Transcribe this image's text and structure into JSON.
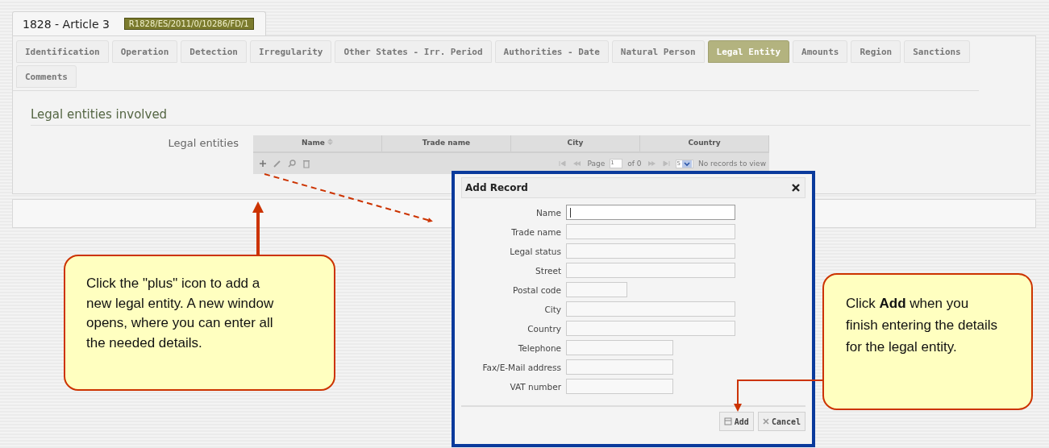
{
  "record": {
    "title": "1828 - Article 3",
    "reference": "R1828/ES/2011/0/10286/FD/1"
  },
  "tabs": [
    {
      "label": "Identification",
      "selected": false
    },
    {
      "label": "Operation",
      "selected": false
    },
    {
      "label": "Detection",
      "selected": false
    },
    {
      "label": "Irregularity",
      "selected": false
    },
    {
      "label": "Other States - Irr. Period",
      "selected": false
    },
    {
      "label": "Authorities - Date",
      "selected": false
    },
    {
      "label": "Natural Person",
      "selected": false
    },
    {
      "label": "Legal Entity",
      "selected": true
    },
    {
      "label": "Amounts",
      "selected": false
    },
    {
      "label": "Region",
      "selected": false
    },
    {
      "label": "Sanctions",
      "selected": false
    },
    {
      "label": "Comments",
      "selected": false
    }
  ],
  "section": {
    "title": "Legal entities involved",
    "field_label": "Legal entities"
  },
  "grid": {
    "columns": [
      {
        "label": "Name",
        "sorted": true
      },
      {
        "label": "Trade name",
        "sorted": false
      },
      {
        "label": "City",
        "sorted": false
      },
      {
        "label": "Country",
        "sorted": false
      }
    ],
    "pager": {
      "page_label": "Page",
      "page": "1",
      "of": "of 0",
      "page_size": "5",
      "status": "No records to view"
    }
  },
  "dialog": {
    "title": "Add Record",
    "fields": [
      {
        "label": "Name",
        "kind": "long",
        "focused": true
      },
      {
        "label": "Trade name",
        "kind": "long",
        "focused": false
      },
      {
        "label": "Legal status",
        "kind": "long",
        "focused": false
      },
      {
        "label": "Street",
        "kind": "long",
        "focused": false
      },
      {
        "label": "Postal code",
        "kind": "short",
        "focused": false
      },
      {
        "label": "City",
        "kind": "long",
        "focused": false
      },
      {
        "label": "Country",
        "kind": "long",
        "focused": false
      },
      {
        "label": "Telephone",
        "kind": "medium",
        "focused": false
      },
      {
        "label": "Fax/E-Mail address",
        "kind": "medium",
        "focused": false
      },
      {
        "label": "VAT number",
        "kind": "medium",
        "focused": false
      }
    ],
    "buttons": [
      {
        "label": "Add",
        "kind": "save"
      },
      {
        "label": "Cancel",
        "kind": "cancel"
      }
    ]
  },
  "callouts": [
    {
      "text": "Click the \"plus\" icon to add a new legal entity. A new window opens, where you can enter all the needed details.",
      "kind": "left"
    },
    {
      "text": "Click **Add** when you finish entering the details for the legal entity.",
      "kind": "right"
    }
  ]
}
